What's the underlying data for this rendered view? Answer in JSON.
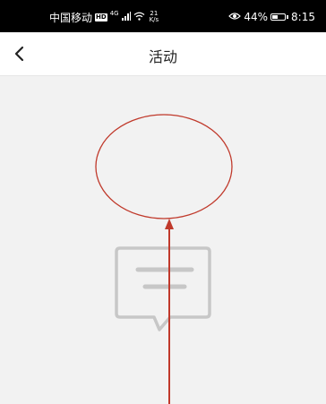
{
  "status_bar": {
    "carrier": "中国移动",
    "hd": "HD",
    "network": "4G",
    "speed_value": "21",
    "speed_unit": "K/s",
    "battery_percent": "44%",
    "battery_level": 0.44,
    "time": "8:15"
  },
  "header": {
    "title": "活动",
    "back_icon": "chevron-left-icon"
  },
  "content": {
    "empty_state_icon": "message-icon"
  },
  "annotation": {
    "color": "#c0392b"
  },
  "colors": {
    "status_bar_bg": "#000000",
    "header_bg": "#ffffff",
    "content_bg": "#f2f2f2",
    "empty_icon": "#c7c7c7"
  }
}
